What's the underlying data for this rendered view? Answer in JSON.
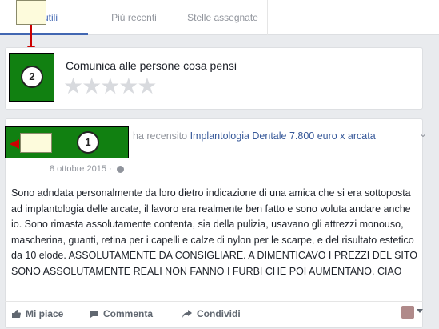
{
  "tabs": [
    {
      "label": "utili"
    },
    {
      "label": "Più recenti"
    },
    {
      "label": "Stelle assegnate"
    },
    {
      "label": ""
    }
  ],
  "annotations": {
    "circle_2": "2",
    "circle_1": "1"
  },
  "compose": {
    "prompt": "Comunica alle persone cosa pensi",
    "stars": "★★★★★"
  },
  "post": {
    "headline_prefix": "ha recensito ",
    "headline_link": "Implantologia Dentale 7.800 euro x arcata",
    "date": "8 ottobre 2015 ·",
    "body": "Sono adndata personalmente da loro dietro indicazione di una amica che si era sottoposta ad implantologia delle arcate, il lavoro era realmente ben fatto e sono voluta andare anche io. Sono rimasta assolutamente contenta, sia della pulizia, usavano gli attrezzi monouso, mascherina, guanti, retina per i capelli e calze di nylon per le scarpe, e del risultato estetico da 10 elode. ASSOLUTAMENTE DA CONSIGLIARE. A DIMENTICAVO I PREZZI DEL SITO SONO ASSOLUTAMENTE REALI NON FANNO I FURBI CHE POI AUMENTANO. CIAO",
    "chevron": "⌄"
  },
  "actions": {
    "like": "Mi piace",
    "comment": "Commenta",
    "share": "Condividi"
  },
  "colors": {
    "brand": "#4267b2",
    "link": "#365899",
    "annotation_green": "#118011",
    "annotation_red": "#cc0000"
  }
}
